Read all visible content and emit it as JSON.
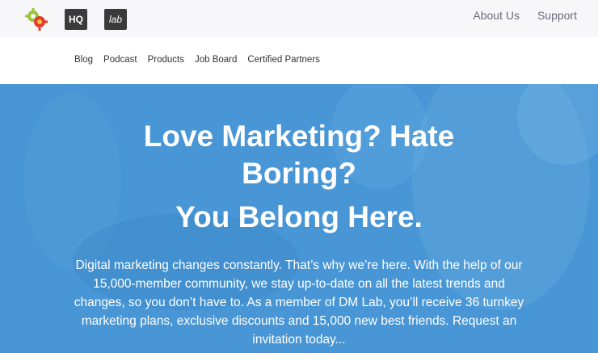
{
  "header": {
    "about_label": "About Us",
    "support_label": "Support",
    "hq_logo_text": "HQ",
    "lab_logo_text": "lab"
  },
  "nav": {
    "items": [
      "Blog",
      "Podcast",
      "Products",
      "Job Board",
      "Certified Partners"
    ]
  },
  "hero": {
    "title_line1": "Love Marketing? Hate Boring?",
    "title_line2": "You Belong Here.",
    "body": "Digital marketing changes constantly. That’s why we’re here. With the help of our 15,000-member community, we stay up-to-date on all the latest trends and changes, so you don’t have to. As a member of DM Lab, you’ll receive 36 turnkey marketing plans, exclusive discounts and 15,000 new best friends. Request an invitation today...",
    "color": "#4a97d6"
  }
}
